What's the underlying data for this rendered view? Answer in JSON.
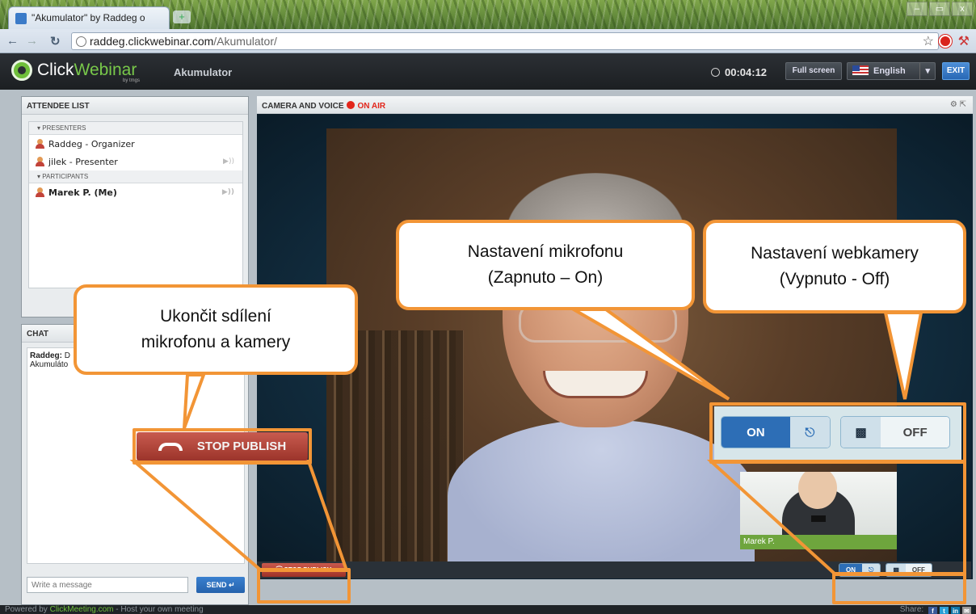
{
  "browser": {
    "tab_title": "\"Akumulator\" by Raddeg o",
    "url_host": "raddeg.clickwebinar.com",
    "url_path": "/Akumulator/",
    "window_controls": [
      "–",
      "▭",
      "x"
    ]
  },
  "header": {
    "logo_a": "Click",
    "logo_b": "Webinar",
    "logo_sub": "by tmgs",
    "room_title": "Akumulator",
    "timer": "00:04:12",
    "fullscreen_label": "Full screen",
    "language": "English",
    "exit_label": "EXIT"
  },
  "attendees": {
    "title": "ATTENDEE LIST",
    "presenters_label": "PRESENTERS",
    "participants_label": "PARTICIPANTS",
    "presenters": [
      {
        "name": "Raddeg - Organizer"
      },
      {
        "name": "jilek - Presenter"
      }
    ],
    "participants": [
      {
        "name": "Marek P. (Me)"
      }
    ]
  },
  "chat": {
    "title": "CHAT",
    "message_author": "Raddeg:",
    "message_text": " D",
    "message_text2": "Akumuláto",
    "input_placeholder": "Write a message",
    "send_label": "SEND"
  },
  "camera": {
    "title": "CAMERA AND VOICE",
    "on_air": "ON AIR",
    "presenter_name": "jilek",
    "self_name": "Marek P.",
    "stop_publish": "STOP PUBLISH",
    "mic_state": "ON",
    "cam_state": "OFF"
  },
  "footer": {
    "powered_by": "Powered by ",
    "powered_link": "ClickMeeting.com",
    "powered_rest": " - Host your own meeting",
    "share_label": "Share:",
    "share_icons": [
      "f",
      "t",
      "in",
      "✉"
    ]
  },
  "callouts": {
    "stop_line1": "Ukončit sdílení",
    "stop_line2": "mikrofonu a kamery",
    "mic_line1": "Nastavení mikrofonu",
    "mic_line2": "(Zapnuto – On)",
    "cam_line1": "Nastavení webkamery",
    "cam_line2": "(Vypnuto - Off)"
  },
  "colors": {
    "accent_orange": "#f29536",
    "brand_green": "#6fbf3b",
    "on_air_red": "#e2261b",
    "button_blue": "#2868b5"
  }
}
